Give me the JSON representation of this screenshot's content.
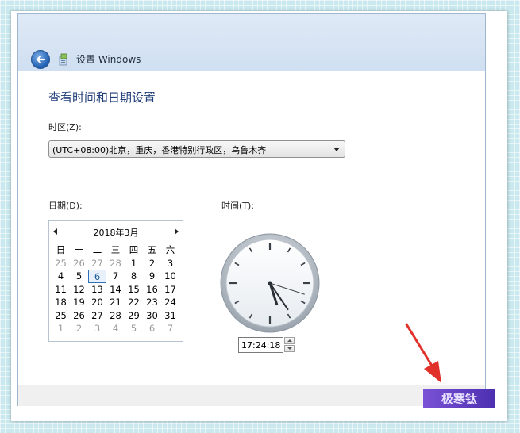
{
  "window": {
    "title": "设置 Windows",
    "heading": "查看时间和日期设置"
  },
  "timezone": {
    "label": "时区(Z):",
    "value": "(UTC+08:00)北京，重庆，香港特别行政区，乌鲁木齐"
  },
  "date": {
    "label": "日期(D):",
    "month_title": "2018年3月",
    "weekdays": [
      "日",
      "一",
      "二",
      "三",
      "四",
      "五",
      "六"
    ],
    "weeks": [
      [
        "25",
        "26",
        "27",
        "28",
        "1",
        "2",
        "3"
      ],
      [
        "4",
        "5",
        "6",
        "7",
        "8",
        "9",
        "10"
      ],
      [
        "11",
        "12",
        "13",
        "14",
        "15",
        "16",
        "17"
      ],
      [
        "18",
        "19",
        "20",
        "21",
        "22",
        "23",
        "24"
      ],
      [
        "25",
        "26",
        "27",
        "28",
        "29",
        "30",
        "31"
      ],
      [
        "1",
        "2",
        "3",
        "4",
        "5",
        "6",
        "7"
      ]
    ],
    "selected_day": "6"
  },
  "time": {
    "label": "时间(T):",
    "value": "17:24:18",
    "hours": 17,
    "minutes": 24,
    "seconds": 18
  },
  "watermark": "极寒钛",
  "colors": {
    "heading": "#1f3d7a",
    "selection_border": "#2d6fb8",
    "arrow": "#e0322b",
    "watermark_bg": "#6a44cc"
  }
}
